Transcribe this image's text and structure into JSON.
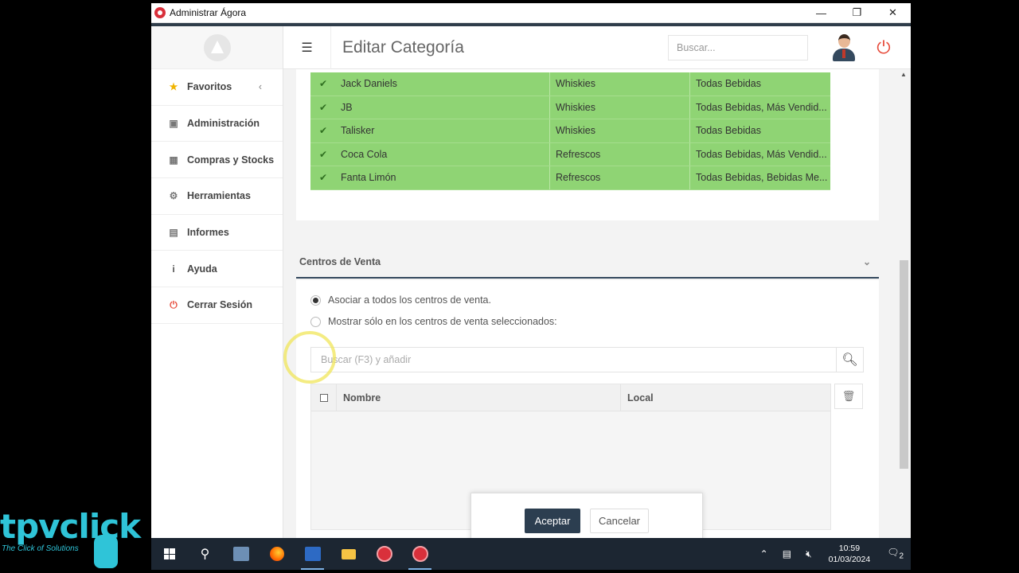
{
  "window": {
    "title": "Administrar Ágora",
    "controls": [
      "minimize-icon",
      "restore-icon",
      "close-icon"
    ]
  },
  "sidebar": {
    "items": [
      {
        "label": "Favoritos",
        "icon": "star-icon",
        "icon_color": "#f0b400"
      },
      {
        "label": "Administración",
        "icon": "bank-icon"
      },
      {
        "label": "Compras y Stocks",
        "icon": "receipt-icon"
      },
      {
        "label": "Herramientas",
        "icon": "gears-icon"
      },
      {
        "label": "Informes",
        "icon": "bar-chart-icon"
      },
      {
        "label": "Ayuda",
        "icon": "info-icon"
      },
      {
        "label": "Cerrar Sesión",
        "icon": "power-icon",
        "icon_color": "#e74c3c"
      }
    ]
  },
  "header": {
    "title": "Editar Categoría",
    "search_placeholder": "Buscar..."
  },
  "products": {
    "rows": [
      {
        "name": "Jack Daniels",
        "family": "Whiskies",
        "categories": "Todas Bebidas"
      },
      {
        "name": "JB",
        "family": "Whiskies",
        "categories": "Todas Bebidas, Más Vendid..."
      },
      {
        "name": "Talisker",
        "family": "Whiskies",
        "categories": "Todas Bebidas"
      },
      {
        "name": "Coca Cola",
        "family": "Refrescos",
        "categories": "Todas Bebidas, Más Vendid..."
      },
      {
        "name": "Fanta Limón",
        "family": "Refrescos",
        "categories": "Todas Bebidas, Bebidas Me..."
      }
    ],
    "row_color": "#8fd474"
  },
  "centros": {
    "title": "Centros de Venta",
    "option_all": "Asociar a todos los centros de venta.",
    "option_selected": "Mostrar sólo en los centros de venta seleccionados:",
    "search_placeholder": "Buscar (F3) y añadir",
    "columns": [
      "Nombre",
      "Local"
    ]
  },
  "dialog": {
    "ok": "Aceptar",
    "cancel": "Cancelar"
  },
  "taskbar": {
    "time": "10:59",
    "date": "01/03/2024",
    "notifications": "2"
  },
  "watermark": {
    "brand": "tpvclick",
    "tagline": "The Click of Solutions"
  },
  "colors": {
    "accent": "#2c3e50",
    "power": "#e74c3c"
  }
}
